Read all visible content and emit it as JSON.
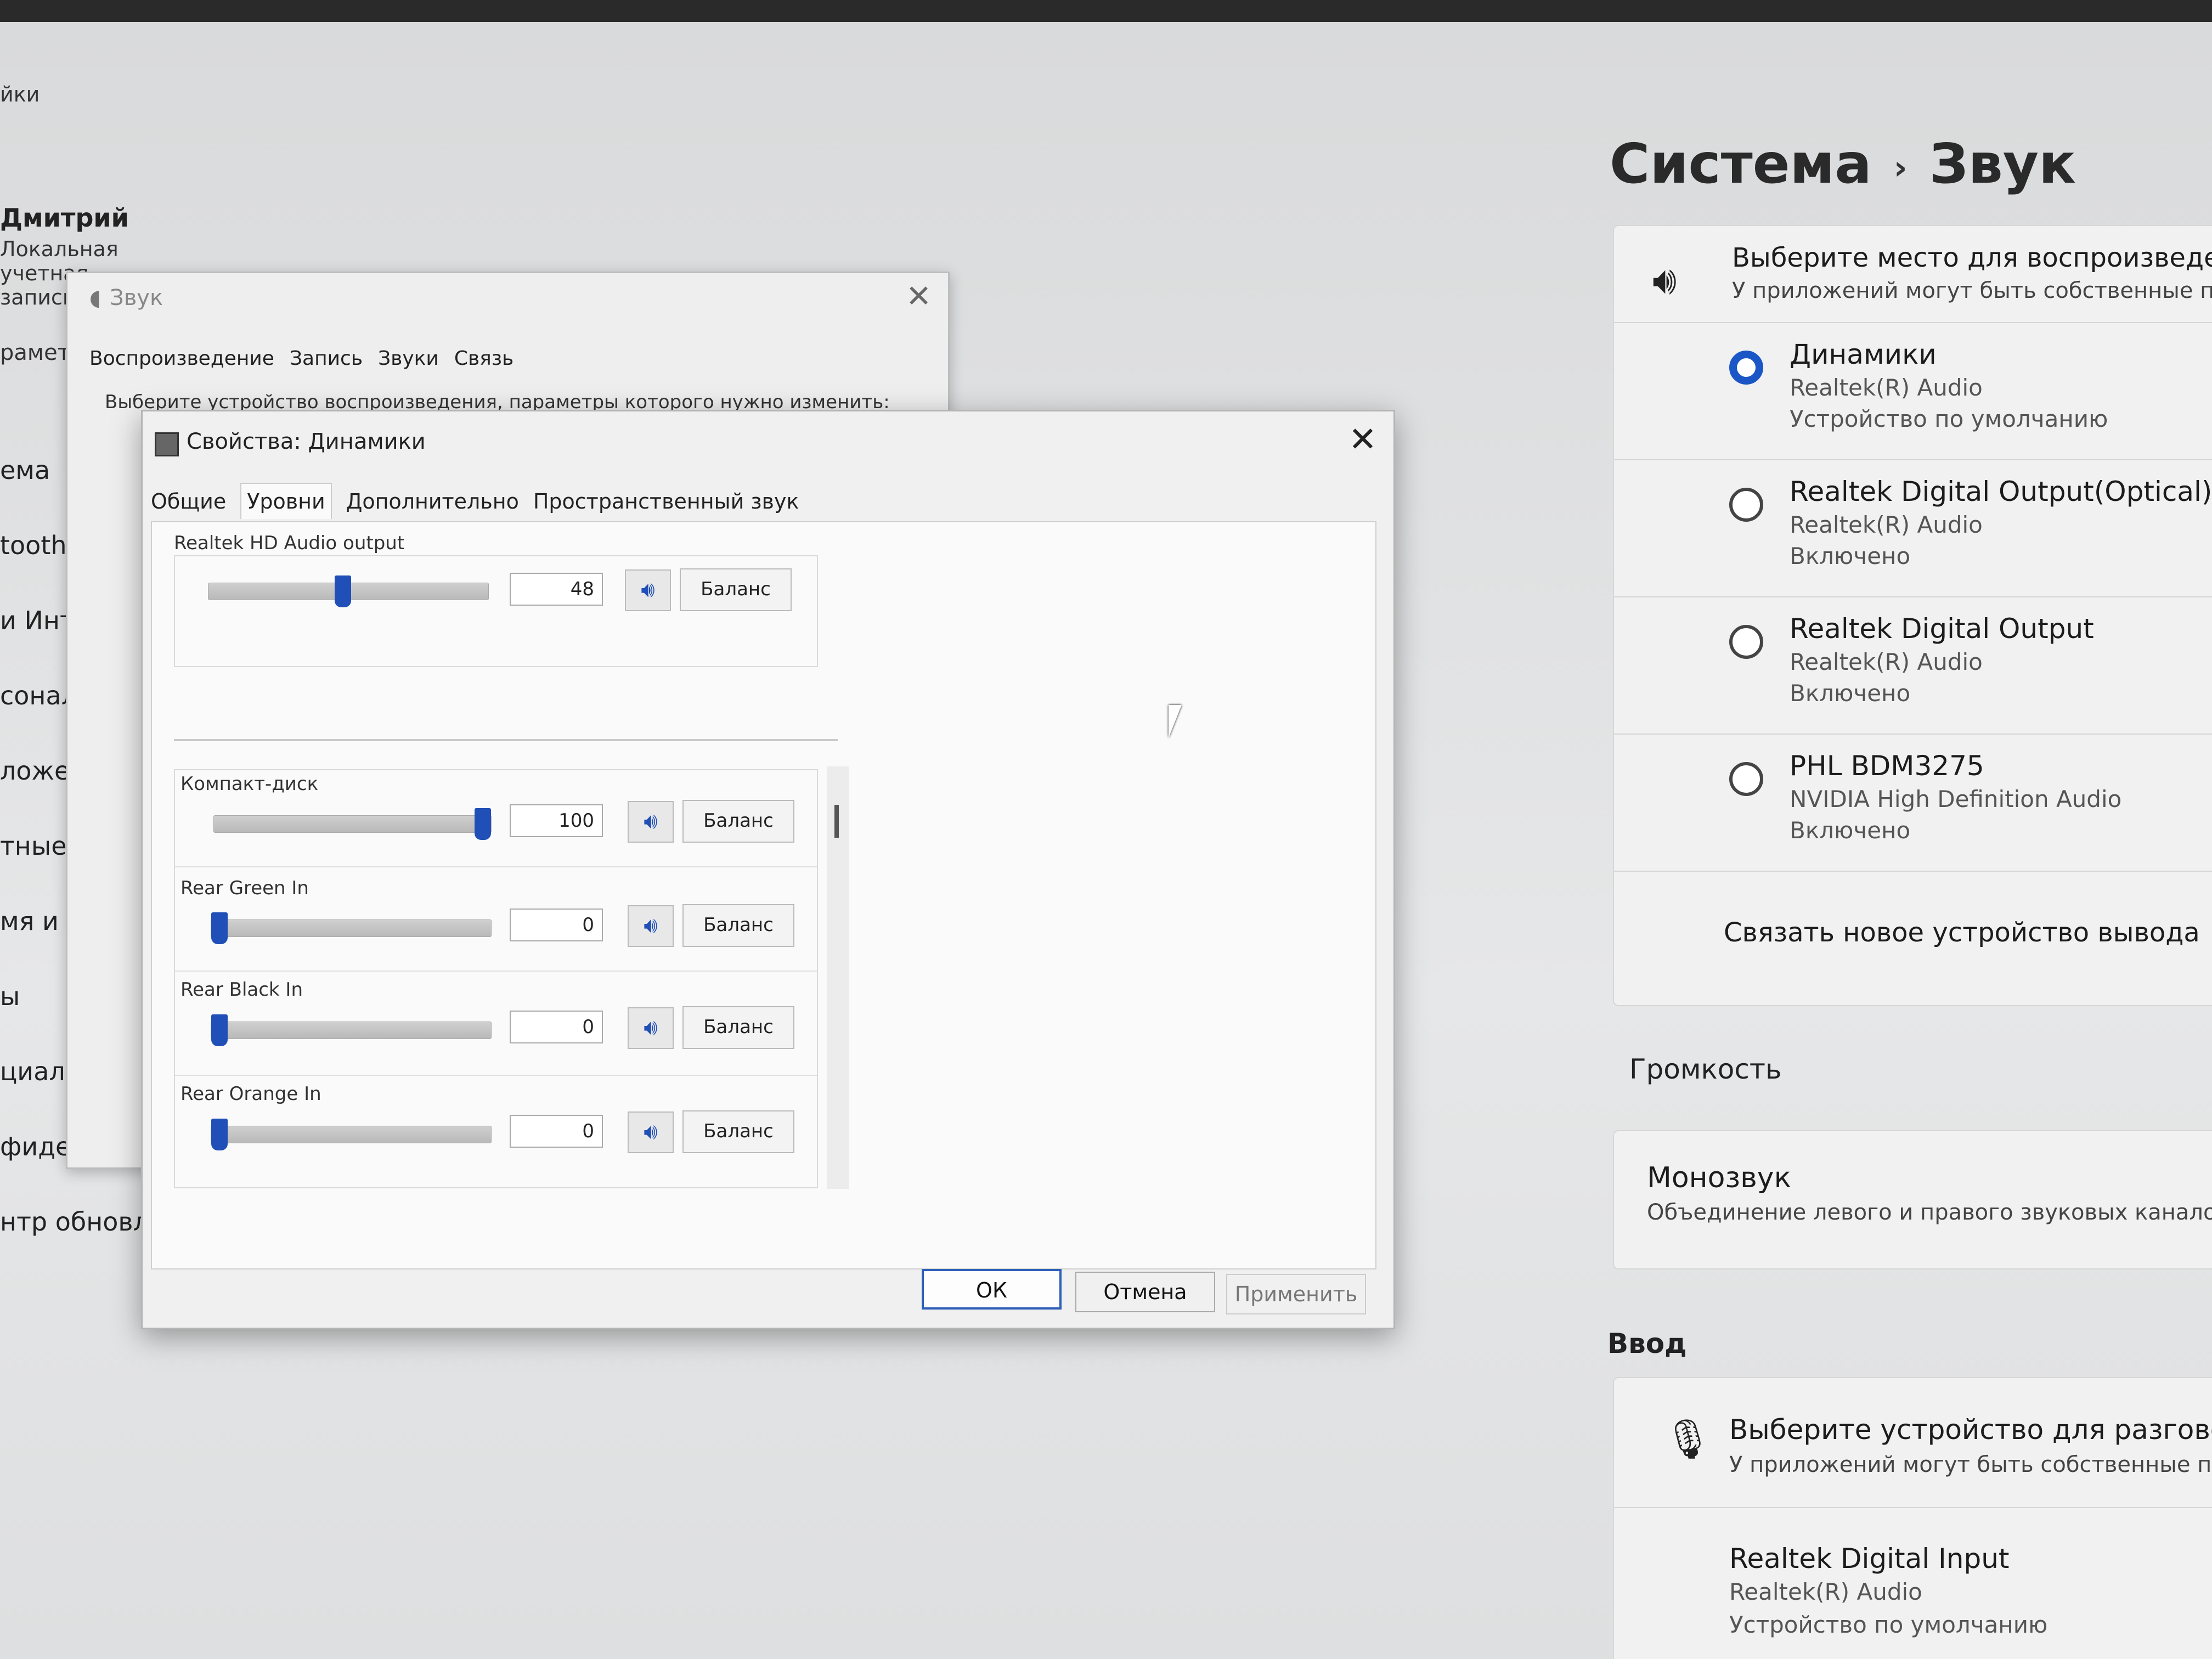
{
  "sidebar": {
    "app_title_fragment": "йки",
    "user_name": "Дмитрий",
    "account_type": "Локальная учетная запись",
    "search_fragment": "раметр",
    "nav_items": [
      "ема",
      "tooth и",
      "и Инт",
      "сонали",
      "ложен",
      "тные за",
      "мя и яз",
      "ы",
      "циальн",
      "фиден",
      "нтр обновле"
    ]
  },
  "settings": {
    "breadcrumb_parent": "Система",
    "breadcrumb_sep": "›",
    "breadcrumb_current": "Звук",
    "output": {
      "title": "Выберите место для воспроизведен",
      "subtitle": "У приложений могут быть собственные па",
      "devices": [
        {
          "name": "Динамики",
          "driver": "Realtek(R) Audio",
          "status": "Устройство по умолчанию",
          "selected": true
        },
        {
          "name": "Realtek Digital Output(Optical)",
          "driver": "Realtek(R) Audio",
          "status": "Включено",
          "selected": false
        },
        {
          "name": "Realtek Digital Output",
          "driver": "Realtek(R) Audio",
          "status": "Включено",
          "selected": false
        },
        {
          "name": "PHL BDM3275",
          "driver": "NVIDIA High Definition Audio",
          "status": "Включено",
          "selected": false
        }
      ],
      "pair_link": "Связать новое устройство вывода"
    },
    "volume_label": "Громкость",
    "mono": {
      "title": "Монозвук",
      "subtitle": "Объединение левого и правого звуковых каналов в"
    },
    "input_label": "Ввод",
    "input": {
      "title": "Выберите устройство для разговора ил",
      "subtitle": "У приложений могут быть собственные парам",
      "device_name": "Realtek Digital Input",
      "device_driver": "Realtek(R) Audio",
      "device_status": "Устройство по умолчанию"
    }
  },
  "sound_dialog": {
    "title": "Звук",
    "tabs": [
      "Воспроизведение",
      "Запись",
      "Звуки",
      "Связь"
    ],
    "prompt": "Выберите устройство воспроизведения, параметры которого нужно изменить:"
  },
  "props_dialog": {
    "title": "Свойства: Динамики",
    "tabs": [
      "Общие",
      "Уровни",
      "Дополнительно",
      "Пространственный звук"
    ],
    "active_tab": "Уровни",
    "master": {
      "label": "Realtek HD Audio output",
      "value": "48",
      "level": 0.48,
      "balance": "Баланс"
    },
    "channels": [
      {
        "label": "Компакт-диск",
        "value": "100",
        "level": 1.0,
        "balance": "Баланс"
      },
      {
        "label": "Rear Green In",
        "value": "0",
        "level": 0.0,
        "balance": "Баланс"
      },
      {
        "label": "Rear Black In",
        "value": "0",
        "level": 0.0,
        "balance": "Баланс"
      },
      {
        "label": "Rear Orange In",
        "value": "0",
        "level": 0.0,
        "balance": "Баланс"
      }
    ],
    "ok": "ОК",
    "cancel": "Отмена",
    "apply": "Применить"
  },
  "colors": {
    "accent": "#1a56c5",
    "slider_thumb": "#1f4fb7"
  },
  "icons": {
    "speaker": "speaker-icon",
    "mic": "microphone-icon",
    "mute": "speaker-volume-icon"
  }
}
